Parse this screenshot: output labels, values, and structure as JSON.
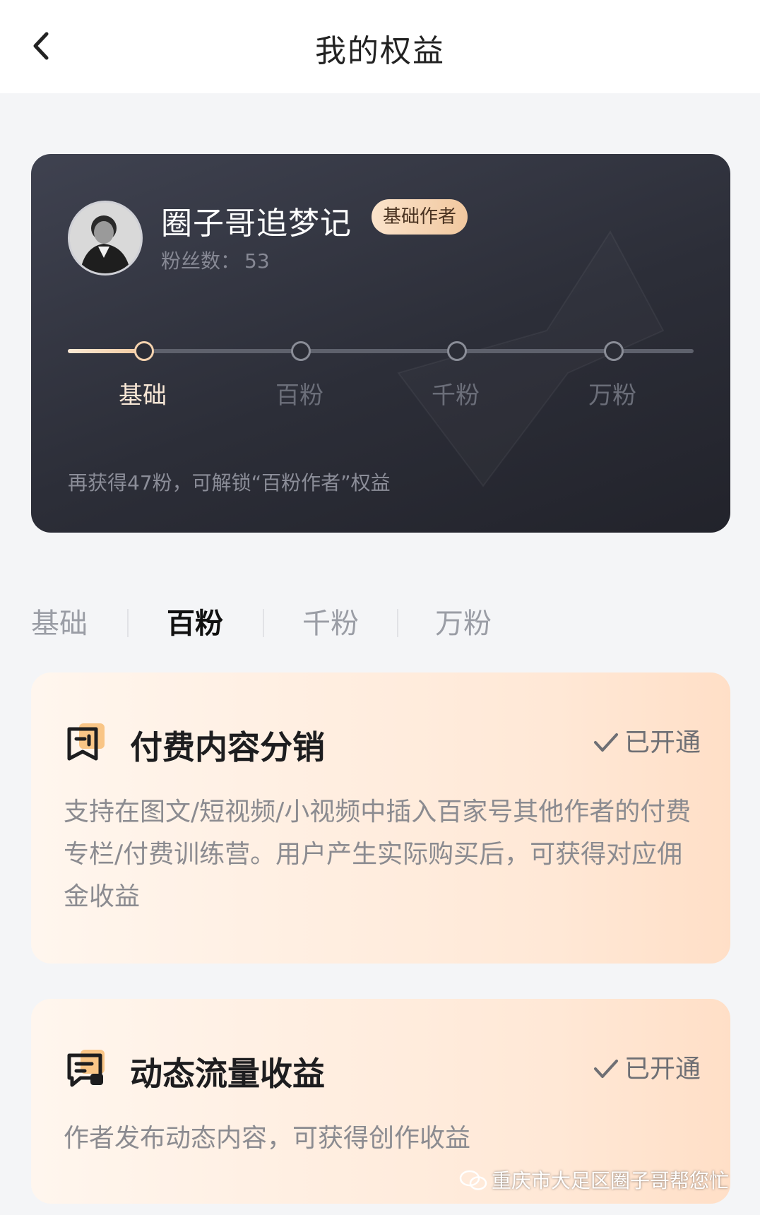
{
  "header": {
    "title": "我的权益",
    "back_icon": "chevron-left-icon"
  },
  "profile": {
    "name": "圈子哥追梦记",
    "badge": "基础作者",
    "fans_label": "粉丝数：",
    "fans_count": "53",
    "levels": [
      "基础",
      "百粉",
      "千粉",
      "万粉"
    ],
    "current_level_index": 0,
    "progress_fraction": 0.12,
    "unlock_hint": "再获得47粉，可解锁“百粉作者”权益"
  },
  "tabs": [
    {
      "label": "基础",
      "active": false
    },
    {
      "label": "百粉",
      "active": true
    },
    {
      "label": "千粉",
      "active": false
    },
    {
      "label": "万粉",
      "active": false
    }
  ],
  "benefits": [
    {
      "icon": "bookmark-icon",
      "title": "付费内容分销",
      "status": "已开通",
      "description": "支持在图文/短视频/小视频中插入百家号其他作者的付费专栏/付费训练营。用户产生实际购买后，可获得对应佣金收益"
    },
    {
      "icon": "message-icon",
      "title": "动态流量收益",
      "status": "已开通",
      "description": "作者发布动态内容，可获得创作收益"
    }
  ],
  "watermark": "重庆市大足区圈子哥帮您忙",
  "colors": {
    "accent": "#f1c9a0",
    "card_bg": "#2c2e38",
    "benefit_bg": "#ffe8d6"
  }
}
